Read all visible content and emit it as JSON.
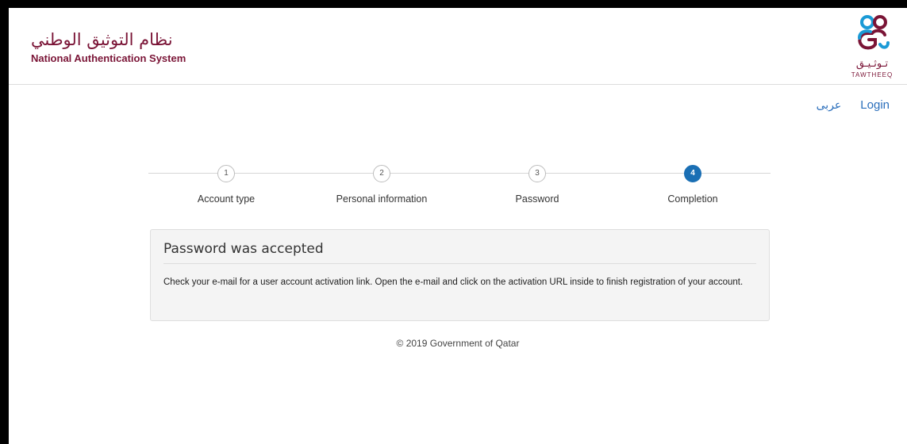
{
  "header": {
    "brand_arabic": "نظام التوثيق الوطني",
    "brand_english": "National Authentication System",
    "logo_arabic": "تـوثـيـق",
    "logo_english": "TAWTHEEQ",
    "brand_color": "#7a1436"
  },
  "topnav": {
    "language_label": "عربى",
    "login_label": "Login",
    "link_color": "#2a6ebb"
  },
  "stepper": {
    "active_step": 4,
    "active_color": "#1a6fb4",
    "steps": [
      {
        "number": "1",
        "label": "Account type"
      },
      {
        "number": "2",
        "label": "Personal information"
      },
      {
        "number": "3",
        "label": "Password"
      },
      {
        "number": "4",
        "label": "Completion"
      }
    ]
  },
  "panel": {
    "title": "Password was accepted",
    "message": "Check your e-mail for a user account activation link. Open the e-mail and click on the activation URL inside to finish registration of your account."
  },
  "footer": {
    "copyright": "© 2019 Government of Qatar"
  }
}
